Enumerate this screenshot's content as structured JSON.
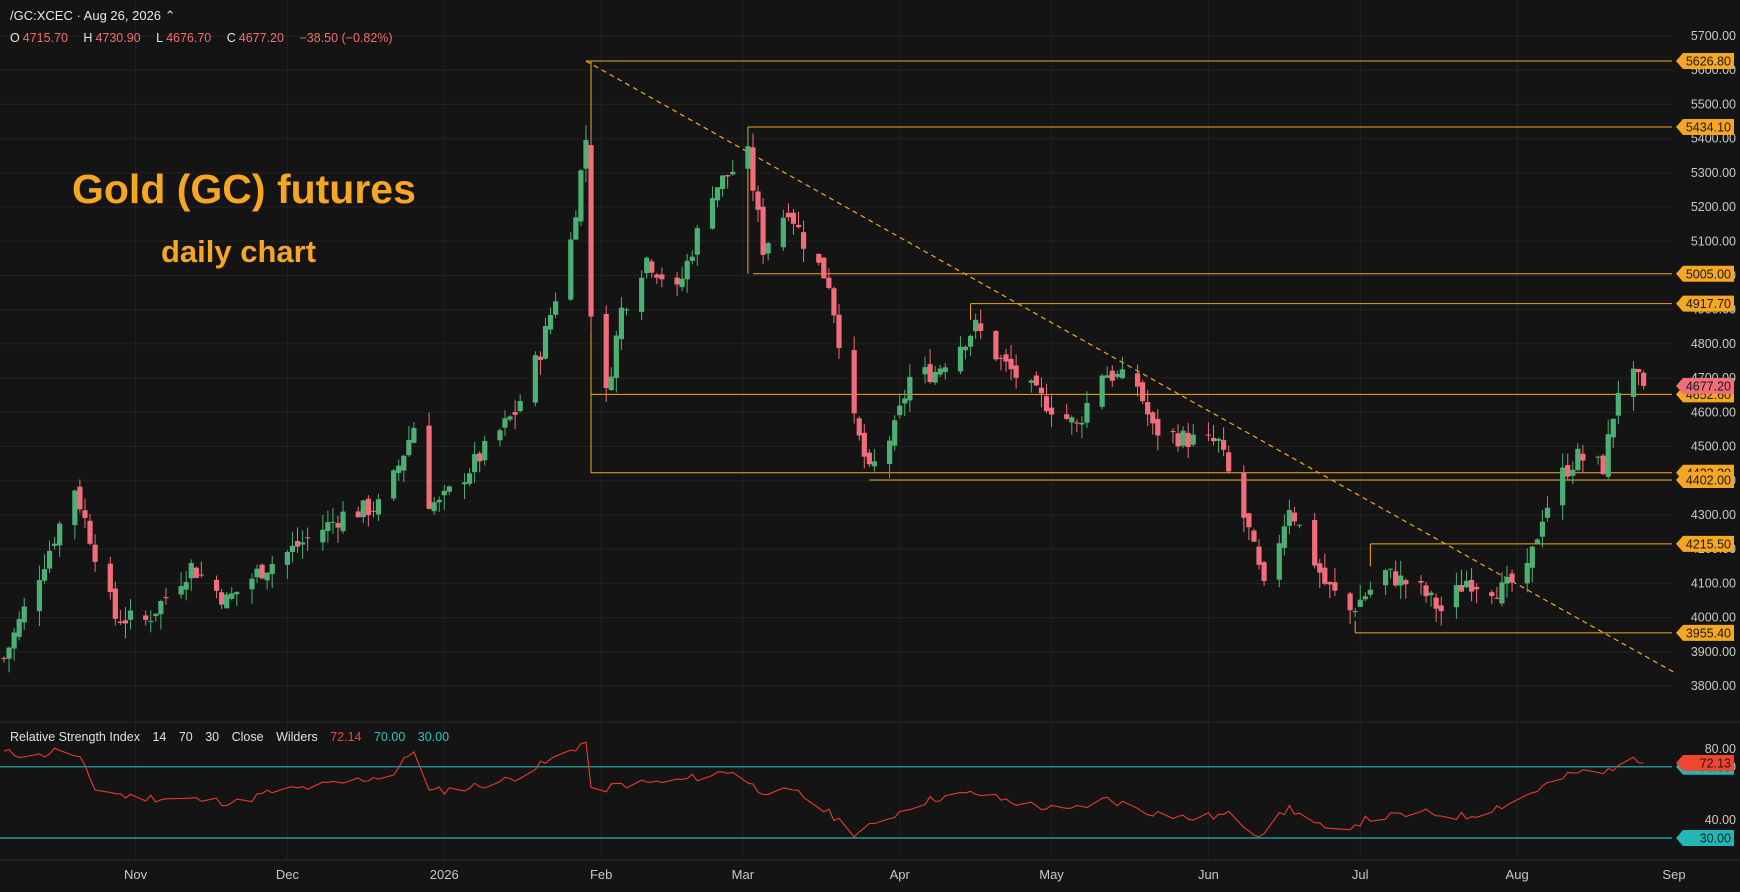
{
  "header": {
    "symbol_line": "/GC:XCEC · Aug 26, 2026 ⌃",
    "ohlc": [
      {
        "key": "O",
        "value": "4715.70"
      },
      {
        "key": "H",
        "value": "4730.90"
      },
      {
        "key": "L",
        "value": "4676.70"
      },
      {
        "key": "C",
        "value": "4677.20"
      },
      {
        "key": "",
        "value": "−38.50 (−0.82%)"
      }
    ]
  },
  "annotation": {
    "title": "Gold (GC) futures",
    "subtitle": "daily chart"
  },
  "rsi_header": {
    "name": "Relative Strength Index",
    "params": [
      "14",
      "70",
      "30",
      "Close",
      "Wilders"
    ],
    "values": [
      {
        "text": "72.14",
        "color": "#f0452f"
      },
      {
        "text": "70.00",
        "color": "#26c6c6"
      },
      {
        "text": "30.00",
        "color": "#26c6c6"
      }
    ]
  },
  "colors": {
    "up": "#4caf73",
    "down": "#f26d7a",
    "level": "#f5a623",
    "rsi_line": "#e83b2c",
    "rsi_band": "#26b5b5",
    "grid": "#222222",
    "bg": "#141414"
  },
  "chart_data": [
    {
      "type": "candlestick",
      "ylim": [
        3750,
        5780
      ],
      "price_ticks": [
        "3800.00",
        "3900.00",
        "4000.00",
        "4100.00",
        "4200.00",
        "4300.00",
        "4400.00",
        "4500.00",
        "4600.00",
        "4700.00",
        "4800.00",
        "4900.00",
        "5000.00",
        "5100.00",
        "5200.00",
        "5300.00",
        "5400.00",
        "5500.00",
        "5600.00",
        "5700.00"
      ],
      "time_labels": [
        "Nov",
        "Dec",
        "2026",
        "Feb",
        "Mar",
        "Apr",
        "May",
        "Jun",
        "Jul",
        "Aug",
        "Sep"
      ],
      "levels": [
        {
          "price": 5626.8,
          "label": "5626.80",
          "start": "2026-01-29"
        },
        {
          "price": 5434.1,
          "label": "5434.10",
          "start": "2026-03-02"
        },
        {
          "price": 5005.0,
          "label": "5005.00",
          "start": "2026-03-03"
        },
        {
          "price": 4917.7,
          "label": "4917.70",
          "start": "2026-04-15"
        },
        {
          "price": 4652.6,
          "label": "4652.60",
          "start": "2026-01-30"
        },
        {
          "price": 4423.2,
          "label": "4423.20",
          "start": "2026-01-30"
        },
        {
          "price": 4402.0,
          "label": "4402.00",
          "start": "2026-03-26"
        },
        {
          "price": 4215.5,
          "label": "4215.50",
          "start": "2026-07-03"
        },
        {
          "price": 3955.4,
          "label": "3955.40",
          "start": "2026-06-30"
        }
      ],
      "last_price": {
        "price": 4677.2,
        "label": "4677.20"
      },
      "trendline": {
        "from": [
          "2026-01-29",
          5626.8
        ],
        "to": [
          "2026-09-01",
          3840
        ]
      },
      "series": [
        {
          "name": "/GC:XCEC",
          "anchors": [
            [
              "2025-10-06",
              3880
            ],
            [
              "2025-10-15",
              4200
            ],
            [
              "2025-10-20",
              4380
            ],
            [
              "2025-10-28",
              4000
            ],
            [
              "2025-11-03",
              3990
            ],
            [
              "2025-11-12",
              4150
            ],
            [
              "2025-11-19",
              4050
            ],
            [
              "2025-11-25",
              4130
            ],
            [
              "2025-12-05",
              4230
            ],
            [
              "2025-12-12",
              4300
            ],
            [
              "2025-12-20",
              4330
            ],
            [
              "2025-12-26",
              4560
            ],
            [
              "2025-12-29",
              4340
            ],
            [
              "2025-12-31",
              4330
            ],
            [
              "2026-01-08",
              4470
            ],
            [
              "2026-01-15",
              4600
            ],
            [
              "2026-01-20",
              4780
            ],
            [
              "2026-01-26",
              5100
            ],
            [
              "2026-01-29",
              5400
            ],
            [
              "2026-01-30",
              4900
            ],
            [
              "2026-02-02",
              4650
            ],
            [
              "2026-02-05",
              4900
            ],
            [
              "2026-02-10",
              5050
            ],
            [
              "2026-02-16",
              4950
            ],
            [
              "2026-02-23",
              5250
            ],
            [
              "2026-03-02",
              5350
            ],
            [
              "2026-03-05",
              5080
            ],
            [
              "2026-03-10",
              5200
            ],
            [
              "2026-03-13",
              5100
            ],
            [
              "2026-03-18",
              4980
            ],
            [
              "2026-03-23",
              4570
            ],
            [
              "2026-03-26",
              4420
            ],
            [
              "2026-03-31",
              4550
            ],
            [
              "2026-04-03",
              4700
            ],
            [
              "2026-04-08",
              4720
            ],
            [
              "2026-04-16",
              4850
            ],
            [
              "2026-04-21",
              4750
            ],
            [
              "2026-04-28",
              4650
            ],
            [
              "2026-05-06",
              4560
            ],
            [
              "2026-05-11",
              4720
            ],
            [
              "2026-05-18",
              4680
            ],
            [
              "2026-05-21",
              4550
            ],
            [
              "2026-05-28",
              4520
            ],
            [
              "2026-06-03",
              4510
            ],
            [
              "2026-06-05",
              4420
            ],
            [
              "2026-06-09",
              4250
            ],
            [
              "2026-06-12",
              4080
            ],
            [
              "2026-06-17",
              4330
            ],
            [
              "2026-06-24",
              4100
            ],
            [
              "2026-06-29",
              4020
            ],
            [
              "2026-07-06",
              4130
            ],
            [
              "2026-07-13",
              4080
            ],
            [
              "2026-07-17",
              4020
            ],
            [
              "2026-07-22",
              4110
            ],
            [
              "2026-07-29",
              4080
            ],
            [
              "2026-08-03",
              4130
            ],
            [
              "2026-08-06",
              4300
            ],
            [
              "2026-08-10",
              4420
            ],
            [
              "2026-08-13",
              4470
            ],
            [
              "2026-08-18",
              4440
            ],
            [
              "2026-08-21",
              4670
            ],
            [
              "2026-08-24",
              4700
            ],
            [
              "2026-08-26",
              4677.2
            ]
          ]
        }
      ]
    },
    {
      "type": "line",
      "title": "Relative Strength Index",
      "ylim": [
        27,
        84
      ],
      "ticks": [
        "80.00",
        "70.00",
        "40.00"
      ],
      "bands": [
        {
          "value": 70,
          "label": "70.00"
        },
        {
          "value": 30,
          "label": "30.00"
        }
      ],
      "last_value": {
        "value": 72.13,
        "label": "72.13"
      },
      "series": [
        {
          "name": "RSI",
          "anchors": [
            [
              "2025-10-06",
              78
            ],
            [
              "2025-10-13",
              76
            ],
            [
              "2025-10-17",
              80
            ],
            [
              "2025-10-21",
              74
            ],
            [
              "2025-10-24",
              58
            ],
            [
              "2025-10-31",
              53
            ],
            [
              "2025-11-10",
              52
            ],
            [
              "2025-11-21",
              50
            ],
            [
              "2025-11-28",
              56
            ],
            [
              "2025-12-04",
              58
            ],
            [
              "2025-12-12",
              61
            ],
            [
              "2025-12-22",
              66
            ],
            [
              "2025-12-26",
              80
            ],
            [
              "2025-12-29",
              56
            ],
            [
              "2026-01-05",
              58
            ],
            [
              "2026-01-14",
              63
            ],
            [
              "2026-01-21",
              72
            ],
            [
              "2026-01-29",
              84
            ],
            [
              "2026-01-30",
              56
            ],
            [
              "2026-02-05",
              60
            ],
            [
              "2026-02-16",
              62
            ],
            [
              "2026-02-27",
              68
            ],
            [
              "2026-03-04",
              57
            ],
            [
              "2026-03-12",
              55
            ],
            [
              "2026-03-19",
              42
            ],
            [
              "2026-03-23",
              33
            ],
            [
              "2026-03-27",
              37
            ],
            [
              "2026-04-03",
              48
            ],
            [
              "2026-04-09",
              53
            ],
            [
              "2026-04-16",
              55
            ],
            [
              "2026-04-24",
              50
            ],
            [
              "2026-05-04",
              45
            ],
            [
              "2026-05-12",
              52
            ],
            [
              "2026-05-20",
              45
            ],
            [
              "2026-05-28",
              41
            ],
            [
              "2026-06-05",
              43
            ],
            [
              "2026-06-11",
              32
            ],
            [
              "2026-06-17",
              47
            ],
            [
              "2026-06-25",
              33
            ],
            [
              "2026-07-03",
              41
            ],
            [
              "2026-07-14",
              44
            ],
            [
              "2026-07-22",
              42
            ],
            [
              "2026-07-31",
              50
            ],
            [
              "2026-08-07",
              60
            ],
            [
              "2026-08-13",
              67
            ],
            [
              "2026-08-18",
              66
            ],
            [
              "2026-08-22",
              74
            ],
            [
              "2026-08-26",
              72.13
            ]
          ]
        }
      ]
    }
  ]
}
